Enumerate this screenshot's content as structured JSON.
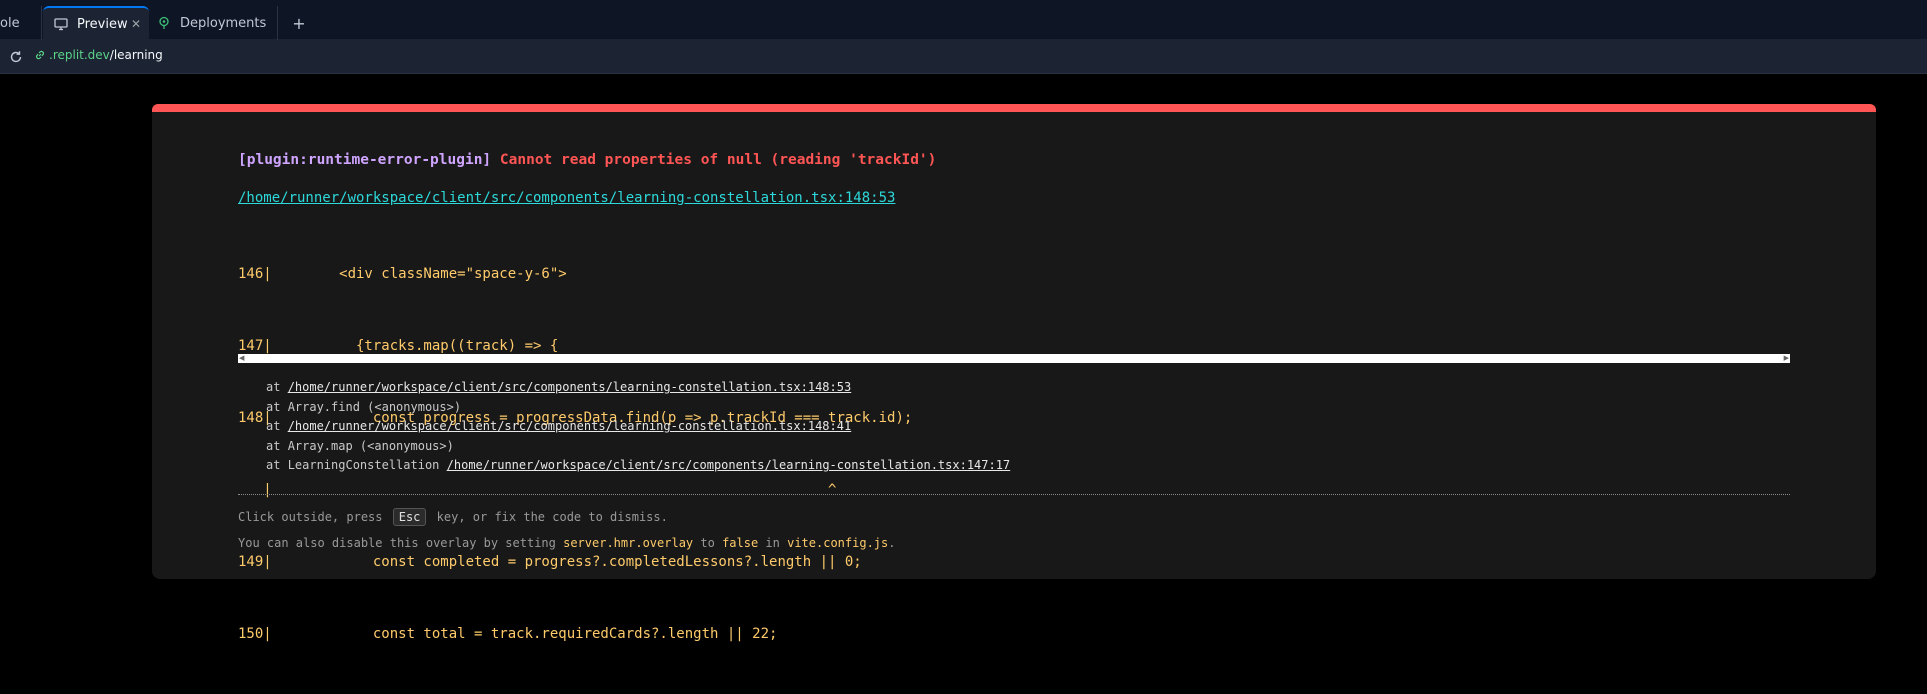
{
  "tabs": [
    {
      "label": "ole",
      "icon": "console-icon"
    },
    {
      "label": "Preview",
      "icon": "monitor-icon",
      "active": true
    },
    {
      "label": "Deployments",
      "icon": "deploy-icon"
    }
  ],
  "new_tab_label": "+",
  "url": {
    "host": ".replit.dev",
    "path": "/learning"
  },
  "error": {
    "plugin": "[plugin:runtime-error-plugin]",
    "message": "Cannot read properties of null (reading 'trackId')",
    "file": "/home/runner/workspace/client/src/components/learning-constellation.tsx:148:53",
    "frame": [
      "146|        <div className=\"space-y-6\">",
      "147|          {tracks.map((track) => {",
      "148|            const progress = progressData.find(p => p.trackId === track.id);",
      "   |                                                                  ^",
      "149|            const completed = progress?.completedLessons?.length || 0;",
      "150|            const total = track.requiredCards?.length || 22;"
    ],
    "stack": [
      {
        "prefix": "at ",
        "fn": "",
        "loc": "/home/runner/workspace/client/src/components/learning-constellation.tsx:148:53"
      },
      {
        "prefix": "at ",
        "fn": "Array.find (<anonymous>)",
        "loc": ""
      },
      {
        "prefix": "at ",
        "fn": "",
        "loc": "/home/runner/workspace/client/src/components/learning-constellation.tsx:148:41"
      },
      {
        "prefix": "at ",
        "fn": "Array.map (<anonymous>)",
        "loc": ""
      },
      {
        "prefix": "at ",
        "fn": "LearningConstellation ",
        "loc": "/home/runner/workspace/client/src/components/learning-constellation.tsx:147:17"
      }
    ],
    "tip1": {
      "before": "Click outside, press",
      "key": "Esc",
      "after": "key, or fix the code to dismiss."
    },
    "tip2": {
      "t1": "You can also disable this overlay by setting ",
      "c1": "server.hmr.overlay",
      "t2": " to ",
      "c2": "false",
      "t3": " in ",
      "c3": "vite.config.js",
      "t4": "."
    }
  },
  "colors": {
    "accent_bar": "#ff5555",
    "plugin": "#cfa4ff",
    "link": "#2dd9da",
    "code": "#ffcb6b",
    "host": "#5bd387"
  }
}
